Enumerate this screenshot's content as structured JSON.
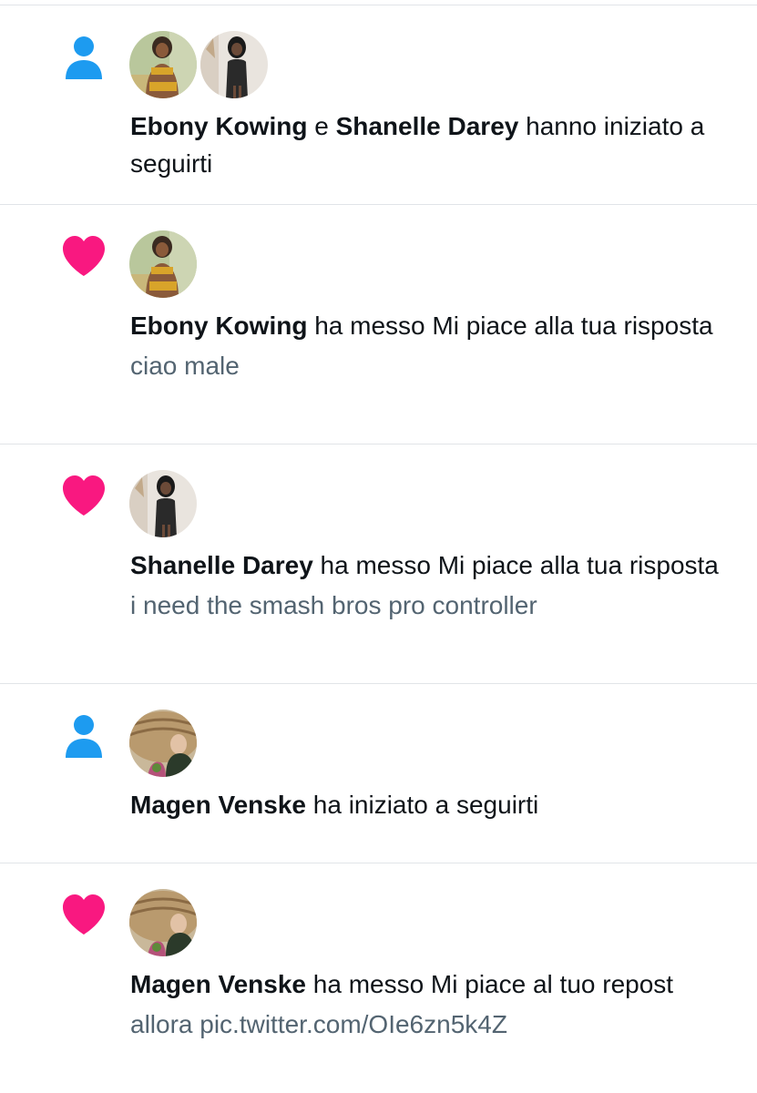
{
  "notifications": [
    {
      "type": "follow",
      "icon": "person-icon",
      "icon_color": "#1d9bf0",
      "users": [
        "Ebony Kowing",
        "Shanelle Darey"
      ],
      "user1": "Ebony Kowing",
      "conj": " e ",
      "user2": "Shanelle Darey",
      "action": " hanno iniziato a seguirti"
    },
    {
      "type": "like",
      "icon": "heart-icon",
      "icon_color": "#f91880",
      "user1": "Ebony Kowing",
      "action": " ha messo Mi piace alla tua risposta",
      "snippet": "ciao male"
    },
    {
      "type": "like",
      "icon": "heart-icon",
      "icon_color": "#f91880",
      "user1": "Shanelle Darey",
      "action": " ha messo Mi piace alla tua risposta",
      "snippet": "i need the smash bros pro controller"
    },
    {
      "type": "follow",
      "icon": "person-icon",
      "icon_color": "#1d9bf0",
      "user1": "Magen Venske",
      "action": " ha iniziato a seguirti"
    },
    {
      "type": "like",
      "icon": "heart-icon",
      "icon_color": "#f91880",
      "user1": "Magen Venske",
      "action": " ha messo Mi piace al tuo repost",
      "snippet": "allora pic.twitter.com/OIe6zn5k4Z"
    }
  ]
}
